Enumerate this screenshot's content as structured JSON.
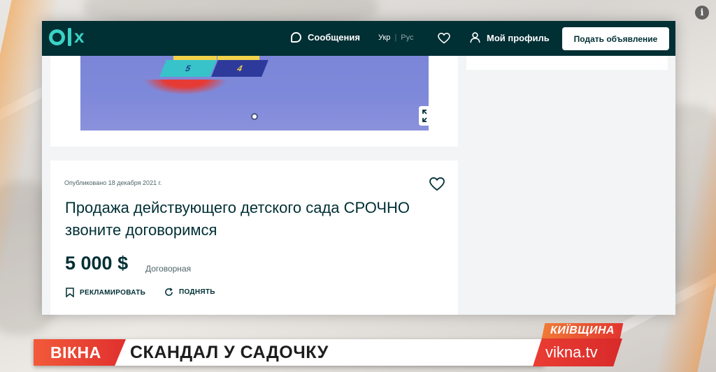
{
  "header": {
    "logo_text": "x",
    "messages_label": "Сообщения",
    "lang_ukr": "Укр",
    "lang_separator": "|",
    "lang_rus": "Рус",
    "profile_label": "Мой профиль",
    "post_ad_label": "Подать объявление"
  },
  "photo": {
    "tile_teal_number": "5",
    "tile_navy_number": "4"
  },
  "ad": {
    "published": "Опубликовано 18 декабря 2021 г.",
    "title": "Продажа действующего детского сада СРОЧНО звоните договоримся",
    "price": "5 000 $",
    "price_note": "Договорная",
    "promote_label": "РЕКЛАМИРОВАТЬ",
    "raise_label": "ПОДНЯТЬ"
  },
  "broadcast": {
    "region": "КИЇВЩИНА",
    "brand": "ВІКНА",
    "headline": "СКАНДАЛ У САДОЧКУ",
    "site": "vikna.tv"
  },
  "overlay": {
    "info_symbol": "i"
  },
  "colors": {
    "olx_dark": "#002f34",
    "olx_accent": "#3ad2c4",
    "broadcast_red": "#e0302e"
  }
}
